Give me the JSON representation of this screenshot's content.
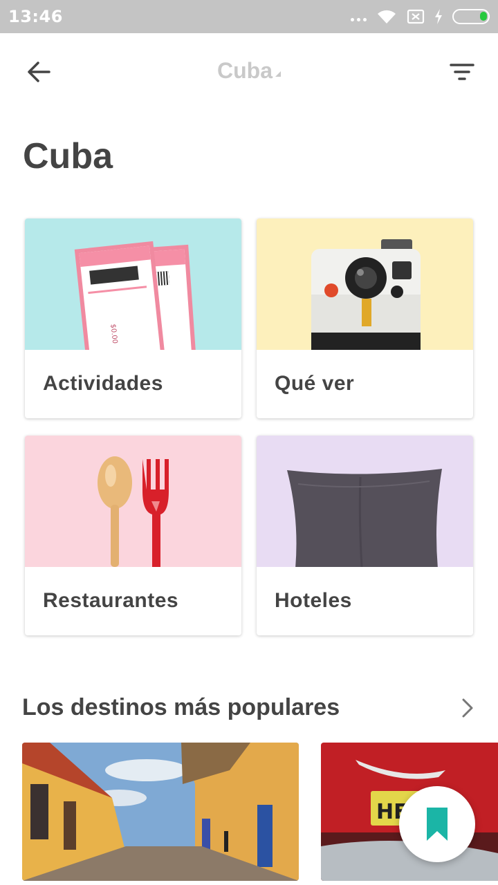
{
  "status_bar": {
    "time": "13:46",
    "icons": [
      "more-dots-icon",
      "wifi-icon",
      "sim-off-icon",
      "charging-icon",
      "battery-icon"
    ]
  },
  "toolbar": {
    "back_icon": "arrow-back-icon",
    "title": "Cuba",
    "filter_icon": "filter-icon"
  },
  "page_title": "Cuba",
  "categories": [
    {
      "label": "Actividades",
      "image": "tickets-image",
      "bg": "#b6e9ea"
    },
    {
      "label": "Qué ver",
      "image": "camera-image",
      "bg": "#fdf0bc"
    },
    {
      "label": "Restaurantes",
      "image": "spoon-fork-image",
      "bg": "#fbd5dd"
    },
    {
      "label": "Hoteles",
      "image": "pillow-image",
      "bg": "#e8dcf3"
    }
  ],
  "popular": {
    "title": "Los destinos más populares",
    "chevron_icon": "chevron-right-icon",
    "items": [
      {
        "image": "colonial-street-image"
      },
      {
        "image": "classic-car-image"
      }
    ]
  },
  "fab": {
    "icon": "bookmark-icon",
    "color": "#1bb5a6"
  }
}
